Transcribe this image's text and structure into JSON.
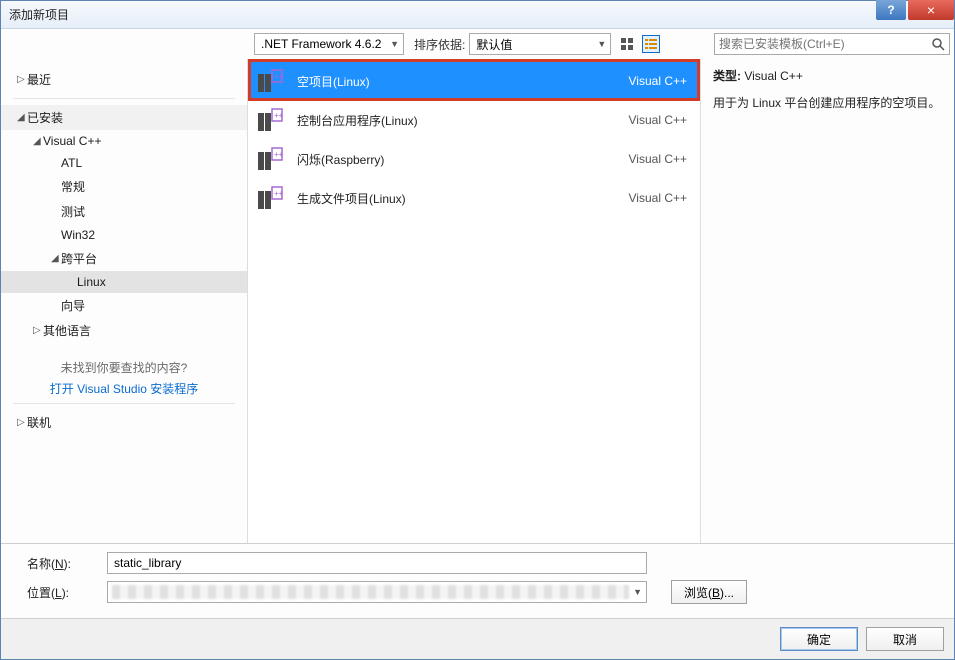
{
  "window_title": "添加新项目",
  "titlebar": {
    "help": "?",
    "close": "×"
  },
  "toolbar": {
    "framework": ".NET Framework 4.6.2",
    "sort_label": "排序依据:",
    "sort_value": "默认值",
    "search_placeholder": "搜索已安装模板(Ctrl+E)"
  },
  "sidebar": {
    "recent": "最近",
    "installed": "已安装",
    "langs": {
      "visualcpp": "Visual C++",
      "atl": "ATL",
      "general": "常规",
      "test": "测试",
      "win32": "Win32",
      "crossplat": "跨平台",
      "linux": "Linux",
      "wizard": "向导",
      "otherlang": "其他语言"
    },
    "hint": "未找到你要查找的内容?",
    "link": "打开 Visual Studio 安装程序",
    "online": "联机"
  },
  "templates": [
    {
      "name": "空项目(Linux)",
      "type": "Visual C++"
    },
    {
      "name": "控制台应用程序(Linux)",
      "type": "Visual C++"
    },
    {
      "name": "闪烁(Raspberry)",
      "type": "Visual C++"
    },
    {
      "name": "生成文件项目(Linux)",
      "type": "Visual C++"
    }
  ],
  "details": {
    "type_label": "类型:",
    "type_value": "Visual C++",
    "desc": "用于为 Linux 平台创建应用程序的空项目。"
  },
  "form": {
    "name_label_pre": "名称(",
    "name_label_key": "N",
    "name_label_post": "):",
    "name_value": "static_library",
    "loc_label_pre": "位置(",
    "loc_label_key": "L",
    "loc_label_post": "):",
    "browse_pre": "浏览(",
    "browse_key": "B",
    "browse_post": ")..."
  },
  "buttons": {
    "ok": "确定",
    "cancel": "取消"
  }
}
